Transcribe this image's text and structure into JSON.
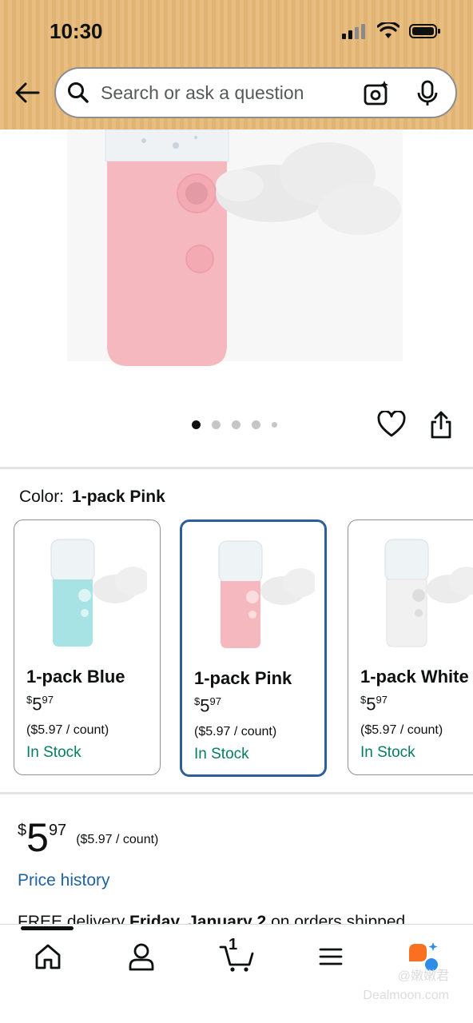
{
  "status_bar": {
    "time": "10:30"
  },
  "search": {
    "placeholder": "Search or ask a question"
  },
  "gallery": {
    "image_count": 5,
    "active_index": 0
  },
  "color": {
    "label": "Color:",
    "selected": "1-pack Pink"
  },
  "swatches": [
    {
      "name": "1-pack Blue",
      "price_symbol": "$",
      "price_whole": "5",
      "price_fraction": "97",
      "unit_price": "($5.97 / count)",
      "stock": "In Stock",
      "body_color": "#a7e3e4"
    },
    {
      "name": "1-pack Pink",
      "price_symbol": "$",
      "price_whole": "5",
      "price_fraction": "97",
      "unit_price": "($5.97 / count)",
      "stock": "In Stock",
      "body_color": "#f6b8bf"
    },
    {
      "name": "1-pack White",
      "price_symbol": "$",
      "price_whole": "5",
      "price_fraction": "97",
      "unit_price": "($5.97 / count)",
      "stock": "In Stock",
      "body_color": "#f1f1f1"
    }
  ],
  "price": {
    "symbol": "$",
    "whole": "5",
    "fraction": "97",
    "per_unit": "($5.97 / count)"
  },
  "price_history": "Price history",
  "delivery": {
    "prefix": "FREE delivery ",
    "day": "Friday, January 2",
    "suffix": " on orders shipped"
  },
  "nav": {
    "cart_count": "1"
  },
  "watermark": {
    "line1": "@嫩嫩君",
    "line2": "Dealmoon.com"
  },
  "colors": {
    "accent_blue": "#2162a1",
    "in_stock_green": "#067d62",
    "selected_border": "#2c5e9e",
    "header_tan": "#e8bd82"
  }
}
